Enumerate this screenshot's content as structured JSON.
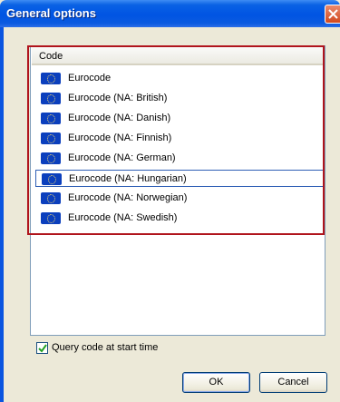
{
  "window": {
    "title": "General options"
  },
  "list": {
    "column_header": "Code",
    "items": [
      {
        "label": "Eurocode",
        "icon": "eu-flag-icon"
      },
      {
        "label": "Eurocode (NA: British)",
        "icon": "eu-flag-icon"
      },
      {
        "label": "Eurocode (NA: Danish)",
        "icon": "eu-flag-icon"
      },
      {
        "label": "Eurocode (NA: Finnish)",
        "icon": "eu-flag-icon"
      },
      {
        "label": "Eurocode (NA: German)",
        "icon": "eu-flag-icon"
      },
      {
        "label": "Eurocode (NA: Hungarian)",
        "icon": "eu-flag-icon",
        "selected": true
      },
      {
        "label": "Eurocode (NA: Norwegian)",
        "icon": "eu-flag-icon"
      },
      {
        "label": "Eurocode (NA: Swedish)",
        "icon": "eu-flag-icon"
      }
    ]
  },
  "options": {
    "query_label": "Query code at start time",
    "query_checked": true
  },
  "buttons": {
    "ok_label": "OK",
    "cancel_label": "Cancel"
  },
  "colors": {
    "title_bar": "#0054e3",
    "highlight_border": "#b0141c",
    "dialog_bg": "#ece9d8"
  }
}
